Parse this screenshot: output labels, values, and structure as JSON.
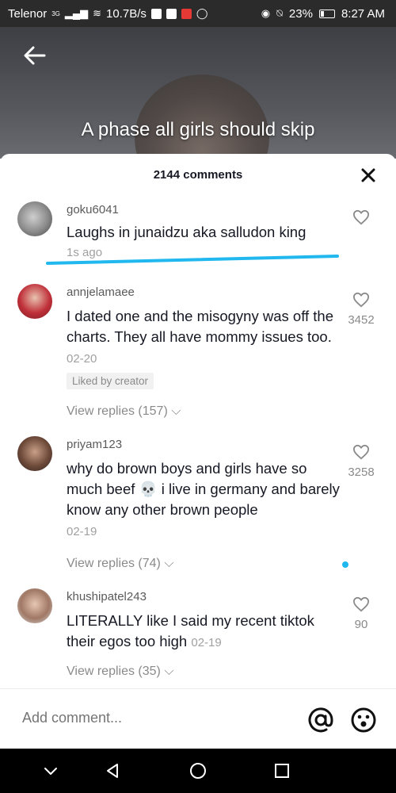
{
  "status_bar": {
    "carrier": "Telenor",
    "network": "3G",
    "speed": "10.7B/s",
    "battery": "23%",
    "time": "8:27 AM"
  },
  "video": {
    "caption": "A phase all girls should skip"
  },
  "comments_sheet": {
    "count_label": "2144 comments",
    "comments": [
      {
        "username": "goku6041",
        "text": "Laughs in junaidzu aka salludon king",
        "time": "1s ago",
        "like_count": "",
        "replies": ""
      },
      {
        "username": "annjelamaee",
        "text": "I dated one and the misogyny was off the charts. They all have mommy issues too.",
        "time": "02-20",
        "like_count": "3452",
        "badge": "Liked by creator",
        "replies": "View replies (157)"
      },
      {
        "username": "priyam123",
        "text_part1": "why do brown boys and girls have so much beef",
        "text_part2": "i live in germany and barely know any other brown people",
        "time": "02-19",
        "like_count": "3258",
        "replies": "View replies (74)"
      },
      {
        "username": "khushipatel243",
        "text": "LITERALLY like I said my recent tiktok their egos too high",
        "time": "02-19",
        "like_count": "90",
        "replies": "View replies (35)"
      }
    ]
  },
  "add_comment": {
    "placeholder": "Add comment..."
  },
  "colors": {
    "accent_blue": "#20b8ee",
    "text_primary": "#161823",
    "text_secondary": "#8a8a8a"
  },
  "icons": {
    "back": "back-arrow-icon",
    "close": "close-icon",
    "like": "heart-outline-icon",
    "mention": "at-sign-icon",
    "emoji": "emoji-icon",
    "skull": "skull-emoji-icon"
  }
}
